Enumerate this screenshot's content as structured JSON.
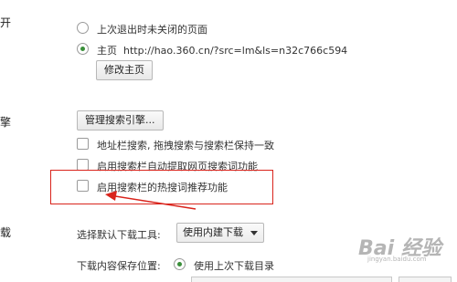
{
  "startup": {
    "section_label": "开",
    "option_last_session": "上次退出时未关闭的页面",
    "option_homepage_prefix": "主页",
    "homepage_url": "http://hao.360.cn/?src=lm&ls=n32c766c594",
    "modify_homepage_button": "修改主页"
  },
  "search": {
    "section_label": "擎",
    "manage_button": "管理搜索引擎...",
    "options": [
      "地址栏搜索, 拖拽搜索与搜索栏保持一致",
      "启用搜索栏自动提取网页搜索词功能",
      "启用搜索栏的热搜词推荐功能"
    ]
  },
  "download": {
    "section_label": "载",
    "default_tool_label": "选择默认下载工具:",
    "default_tool_value": "使用内建下载",
    "save_location_label": "下载内容保存位置:",
    "save_location_option": "使用上次下载目录"
  },
  "colors": {
    "highlight_border": "#d9241c",
    "annotation_arrow": "#d9241c",
    "radio_selected": "#3a8f3a"
  },
  "watermark": {
    "text": "Bai 经验",
    "subtext": "jingyan.baidu.com"
  }
}
